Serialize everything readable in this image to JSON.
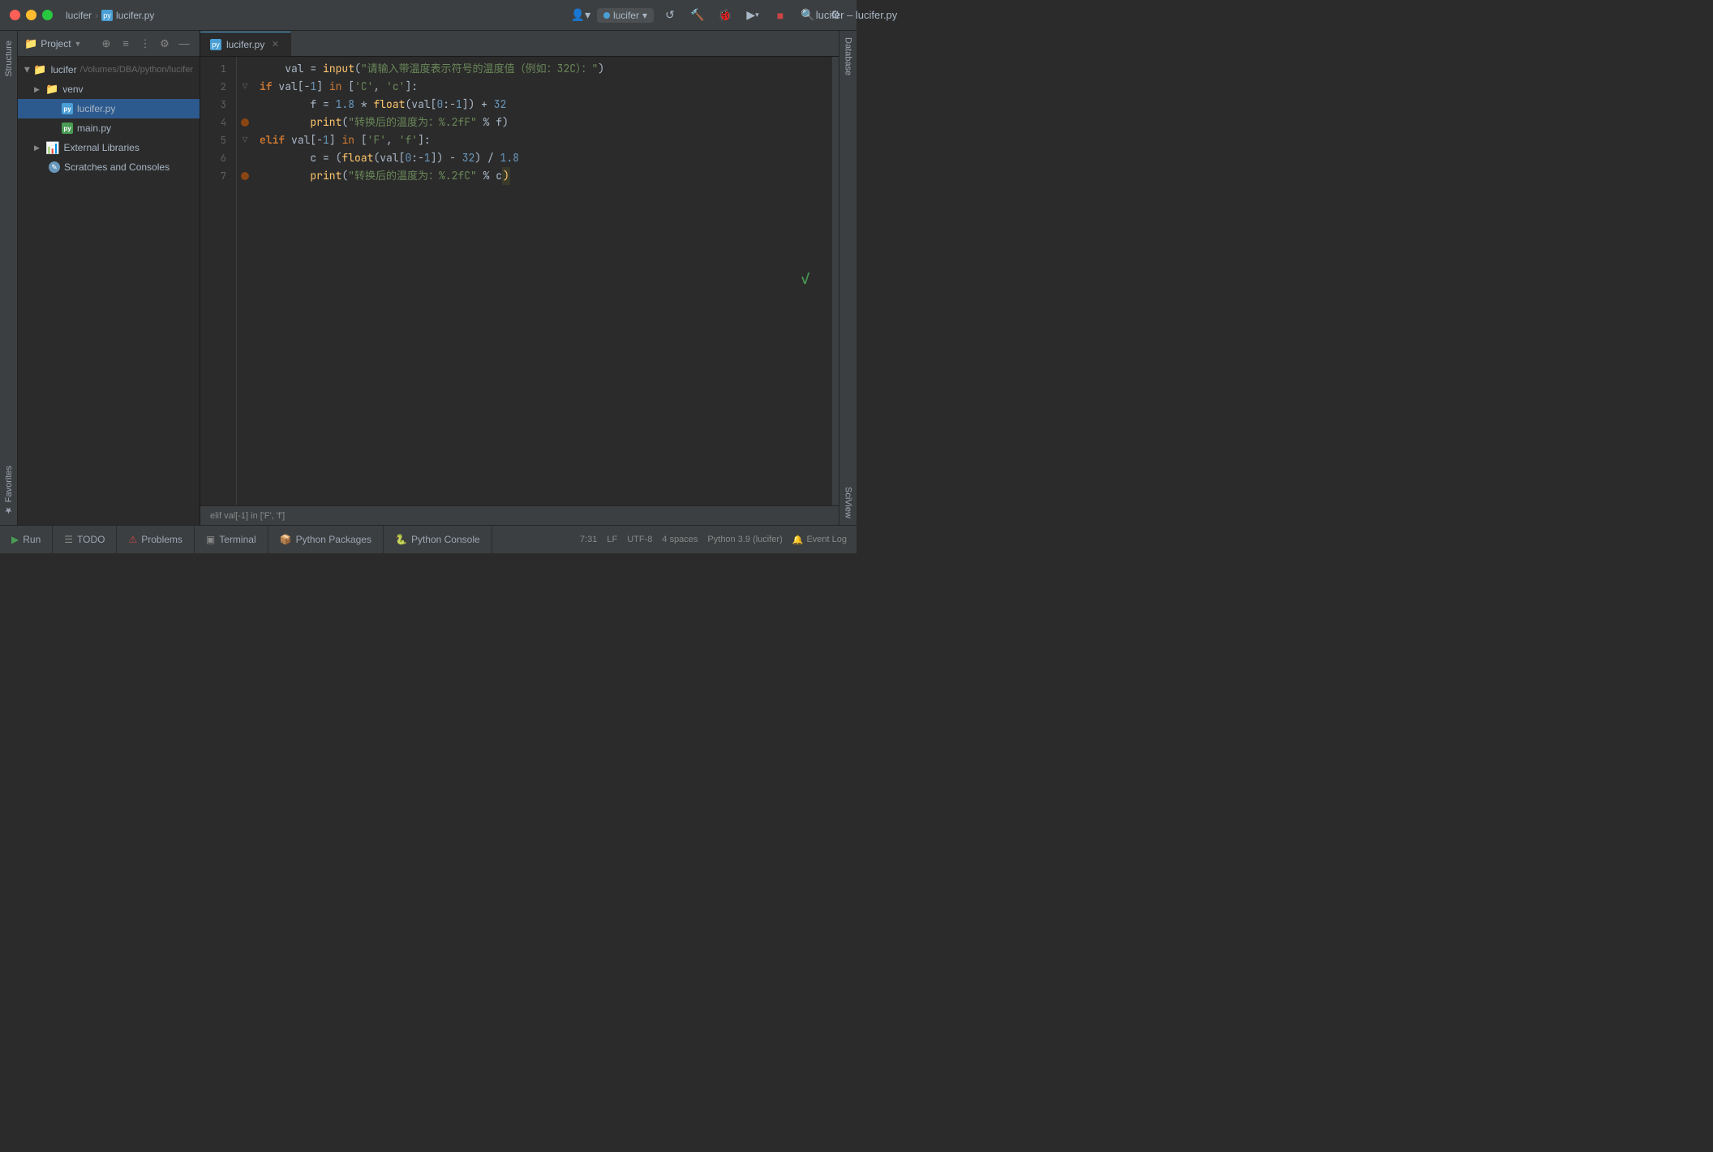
{
  "window": {
    "title": "lucifer – lucifer.py",
    "traffic_lights": [
      "close",
      "minimize",
      "maximize"
    ]
  },
  "titlebar": {
    "breadcrumb_project": "lucifer",
    "breadcrumb_sep": "›",
    "breadcrumb_file": "lucifer.py",
    "title": "lucifer – lucifer.py",
    "run_config_label": "lucifer",
    "buttons": {
      "rerun": "↺",
      "build": "🔨",
      "debug": "🐞",
      "run_coverage": "▶",
      "coverage_dropdown": "▾",
      "stop": "■",
      "search": "🔍",
      "settings": "⚙"
    }
  },
  "project_panel": {
    "title": "Project",
    "root_folder": "lucifer",
    "root_path": "/Volumes/DBA/python/lucifer",
    "items": [
      {
        "id": "venv",
        "label": "venv",
        "type": "folder",
        "indent": 1,
        "collapsed": true
      },
      {
        "id": "lucifer_py",
        "label": "lucifer.py",
        "type": "py",
        "indent": 2,
        "selected": true
      },
      {
        "id": "main_py",
        "label": "main.py",
        "type": "py_green",
        "indent": 2
      },
      {
        "id": "external_libs",
        "label": "External Libraries",
        "type": "external",
        "indent": 1
      },
      {
        "id": "scratches",
        "label": "Scratches and Consoles",
        "type": "scratches",
        "indent": 1
      }
    ]
  },
  "editor": {
    "tab_label": "lucifer.py",
    "lines": [
      {
        "num": 1,
        "code": "    val = input(\"请输入带温度表示符号的温度值（例如：32C）：\")",
        "gutter": ""
      },
      {
        "num": 2,
        "code": "if val[-1] in ['C', 'c']:",
        "gutter": "fold"
      },
      {
        "num": 3,
        "code": "        f = 1.8 * float(val[0:-1]) + 32",
        "gutter": ""
      },
      {
        "num": 4,
        "code": "        print(\"转换后的温度为：%.2fF\" % f)",
        "gutter": "breakpoint"
      },
      {
        "num": 5,
        "code": "elif val[-1] in ['F', 'f']:",
        "gutter": "fold"
      },
      {
        "num": 6,
        "code": "        c = (float(val[0:-1]) - 32) / 1.8",
        "gutter": ""
      },
      {
        "num": 7,
        "code": "        print(\"转换后的温度为：%.2fC\" % c)",
        "gutter": "breakpoint"
      }
    ],
    "status_breadcrumb": "elif val[-1] in ['F', 'f']"
  },
  "right_sidebar": {
    "labels": [
      "Database",
      "SciView"
    ]
  },
  "left_sidebar": {
    "labels": [
      "Structure",
      "Favorites"
    ]
  },
  "bottom_bar": {
    "tabs": [
      {
        "id": "run",
        "icon": "▶",
        "label": "Run",
        "icon_color": "run"
      },
      {
        "id": "todo",
        "icon": "☰",
        "label": "TODO",
        "icon_color": "todo"
      },
      {
        "id": "problems",
        "icon": "⚠",
        "label": "Problems",
        "icon_color": "problems"
      },
      {
        "id": "terminal",
        "icon": "▣",
        "label": "Terminal",
        "icon_color": "terminal"
      },
      {
        "id": "python_packages",
        "icon": "📦",
        "label": "Python Packages",
        "icon_color": "packages"
      },
      {
        "id": "python_console",
        "icon": "🐍",
        "label": "Python Console",
        "icon_color": "console"
      }
    ],
    "status_right": {
      "position": "7:31",
      "line_sep": "LF",
      "encoding": "UTF-8",
      "indent": "4 spaces",
      "python": "Python 3.9 (lucifer)",
      "event_log": "Event Log"
    }
  }
}
